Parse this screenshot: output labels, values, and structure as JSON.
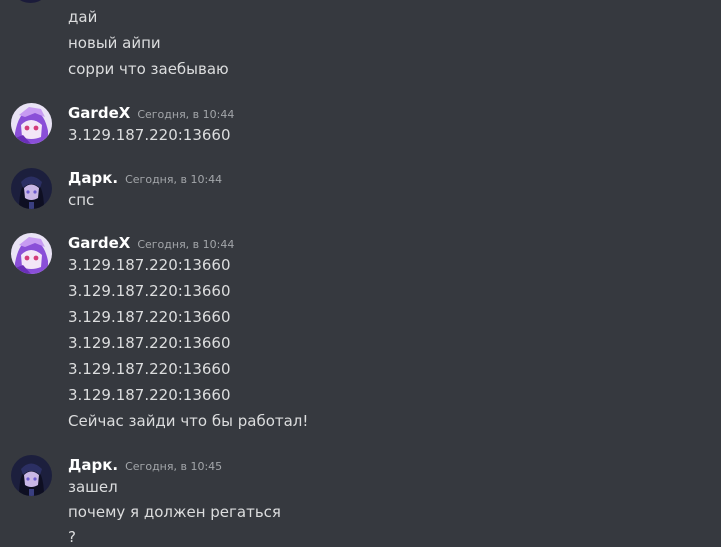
{
  "messages": [
    {
      "lines": [
        "дай",
        "новый айпи",
        "сорри что заебываю"
      ]
    },
    {
      "author": "GardeX",
      "timestamp": "Сегодня, в 10:44",
      "avatar": "gardex-avatar",
      "lines": [
        "3.129.187.220:13660"
      ]
    },
    {
      "author": "Дарк.",
      "timestamp": "Сегодня, в 10:44",
      "avatar": "dark-avatar",
      "lines": [
        "спс"
      ]
    },
    {
      "author": "GardeX",
      "timestamp": "Сегодня, в 10:44",
      "avatar": "gardex-avatar",
      "lines": [
        "3.129.187.220:13660",
        "3.129.187.220:13660",
        "3.129.187.220:13660",
        "3.129.187.220:13660",
        "3.129.187.220:13660",
        "3.129.187.220:13660",
        "Сейчас зайди что бы работал!"
      ]
    },
    {
      "author": "Дарк.",
      "timestamp": "Сегодня, в 10:45",
      "avatar": "dark-avatar",
      "lines": [
        "зашел",
        "почему я должен регаться",
        "?"
      ]
    }
  ]
}
